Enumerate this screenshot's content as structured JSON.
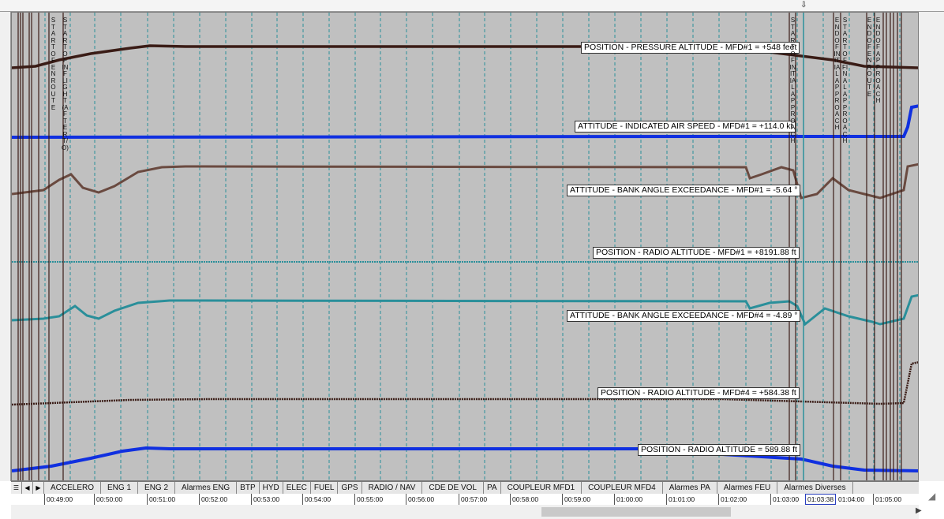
{
  "window": {
    "cursor_marker": "⇩"
  },
  "series": [
    {
      "id": "pressure-altitude",
      "label": "POSITION - PRESSURE ALTITUDE - MFD#1 = +548 feet",
      "color": "#3a1c16"
    },
    {
      "id": "indicated-air-speed",
      "label": "ATTITUDE - INDICATED AIR SPEED - MFD#1 = +114.0 kt",
      "color": "#1030e0"
    },
    {
      "id": "bank-angle-mfd1",
      "label": "ATTITUDE - BANK ANGLE EXCEEDANCE - MFD#1 = -5.64 °",
      "color": "#6a4a40"
    },
    {
      "id": "radio-altitude-mfd1",
      "label": "POSITION - RADIO ALTITUDE - MFD#1 = +8191.88 ft",
      "color": "#2a8f9a"
    },
    {
      "id": "bank-angle-mfd4",
      "label": "ATTITUDE - BANK ANGLE EXCEEDANCE - MFD#4 = -4.89 °",
      "color": "#2a8f9a"
    },
    {
      "id": "radio-altitude-mfd4",
      "label": "POSITION - RADIO ALTITUDE - MFD#4 = +584.38 ft",
      "color": "#3a1c16"
    },
    {
      "id": "radio-altitude",
      "label": "POSITION - RADIO ALTITUDE = 589.88 ft",
      "color": "#1030e0"
    }
  ],
  "events": [
    {
      "id": "start-of-en-route",
      "text": "START OF EN ROUTE"
    },
    {
      "id": "start-of-in-flight",
      "text": "START OF IN FLIGHT (AFTER T/O)"
    },
    {
      "id": "start-of-initial-approach",
      "text": "START OF INITIAL APPROACH"
    },
    {
      "id": "end-of-initial-approach",
      "text": "END OF INITIAL APPROACH"
    },
    {
      "id": "start-of-final-approach",
      "text": "START OF FINAL APPROACH"
    },
    {
      "id": "end-of-en-route",
      "text": "END OF EN ROUTE"
    },
    {
      "id": "end-of-approach",
      "text": "END OF APPROACH"
    }
  ],
  "tabs": [
    "ACCELERO",
    "ENG 1",
    "ENG 2",
    "Alarmes ENG",
    "BTP",
    "HYD",
    "ELEC",
    "FUEL",
    "GPS",
    "RADIO / NAV",
    "CDE DE VOL",
    "PA",
    "COUPLEUR MFD1",
    "COUPLEUR MFD4",
    "Alarmes PA",
    "Alarmes FEU",
    "Alarmes Diverses"
  ],
  "time_ticks": [
    "00:49:00",
    "00:50:00",
    "00:51:00",
    "00:52:00",
    "00:53:00",
    "00:54:00",
    "00:55:00",
    "00:56:00",
    "00:57:00",
    "00:58:00",
    "00:59:00",
    "01:00:00",
    "01:01:00",
    "01:02:00",
    "01:03:00",
    "01:03:38",
    "01:04:00",
    "01:05:00"
  ],
  "selected_time": "01:03:38",
  "colors": {
    "plot_background": "#c0c0c0",
    "grid": "#2a8f9a",
    "event_line": "#3a1c16",
    "cursor_line": "#2a8f9a"
  }
}
